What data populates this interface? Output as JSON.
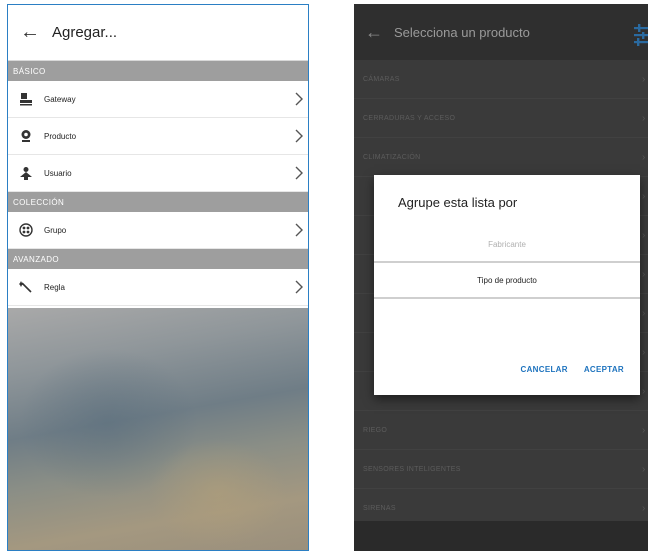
{
  "left": {
    "title": "Agregar...",
    "sections": [
      {
        "header": "BÁSICO",
        "items": [
          {
            "label": "Gateway",
            "icon": "gateway-icon"
          },
          {
            "label": "Producto",
            "icon": "webcam-icon"
          },
          {
            "label": "Usuario",
            "icon": "user-icon"
          }
        ]
      },
      {
        "header": "COLECCIÓN",
        "items": [
          {
            "label": "Grupo",
            "icon": "group-icon"
          }
        ]
      },
      {
        "header": "AVANZADO",
        "items": [
          {
            "label": "Regla",
            "icon": "wand-icon"
          }
        ]
      }
    ]
  },
  "right": {
    "title": "Selecciona un producto",
    "list": [
      "CÁMARAS",
      "CERRADURAS Y ACCESO",
      "CLIMATIZACIÓN",
      "",
      "",
      "",
      "",
      "",
      "",
      "RIEGO",
      "SENSORES INTELIGENTES",
      "SIRENAS"
    ],
    "dialog": {
      "title": "Agrupe esta lista por",
      "option_inactive": "Fabricante",
      "option_selected": "Tipo de producto",
      "cancel": "CANCELAR",
      "accept": "ACEPTAR"
    }
  },
  "colors": {
    "accent": "#1e73be",
    "section_header": "#9e9e9e",
    "dim_overlay": "#3a3a3a"
  }
}
